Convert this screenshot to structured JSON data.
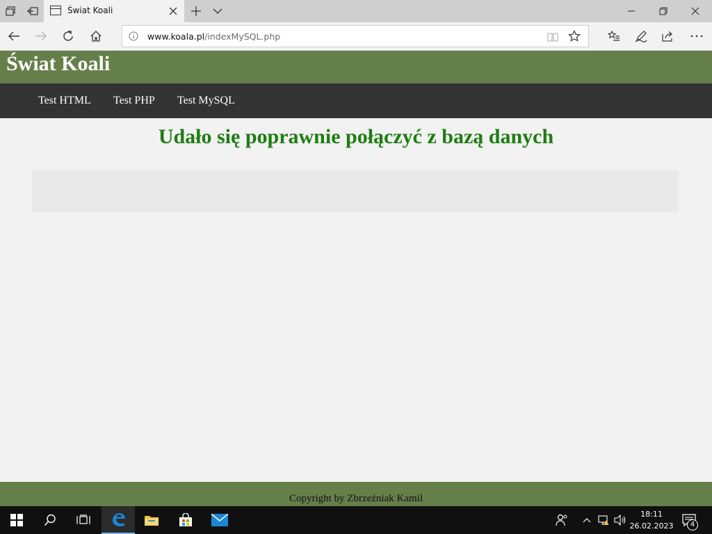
{
  "browser": {
    "tab": {
      "title": "Świat Koali"
    },
    "address": {
      "url_domain": "www.koala.pl",
      "url_path": "/indexMySQL.php"
    }
  },
  "page": {
    "site_title": "Świat Koali",
    "menu": [
      {
        "label": "Test HTML"
      },
      {
        "label": "Test PHP"
      },
      {
        "label": "Test MySQL"
      }
    ],
    "status_message": "Udało się poprawnie połączyć z bazą danych",
    "footer": "Copyright by Zbrzeźniak Kamil"
  },
  "taskbar": {
    "clock_time": "18:11",
    "clock_date": "26.02.2023",
    "notification_count": "4",
    "pinned": [
      "windows-start-icon",
      "search-icon",
      "task-view-icon",
      "edge-icon",
      "file-explorer-icon",
      "store-icon",
      "mail-icon"
    ]
  },
  "colors": {
    "header_bg": "#657f4a",
    "menu_bg": "#333333",
    "status_text": "#1e7d12",
    "page_bg": "#f2f2f2"
  }
}
